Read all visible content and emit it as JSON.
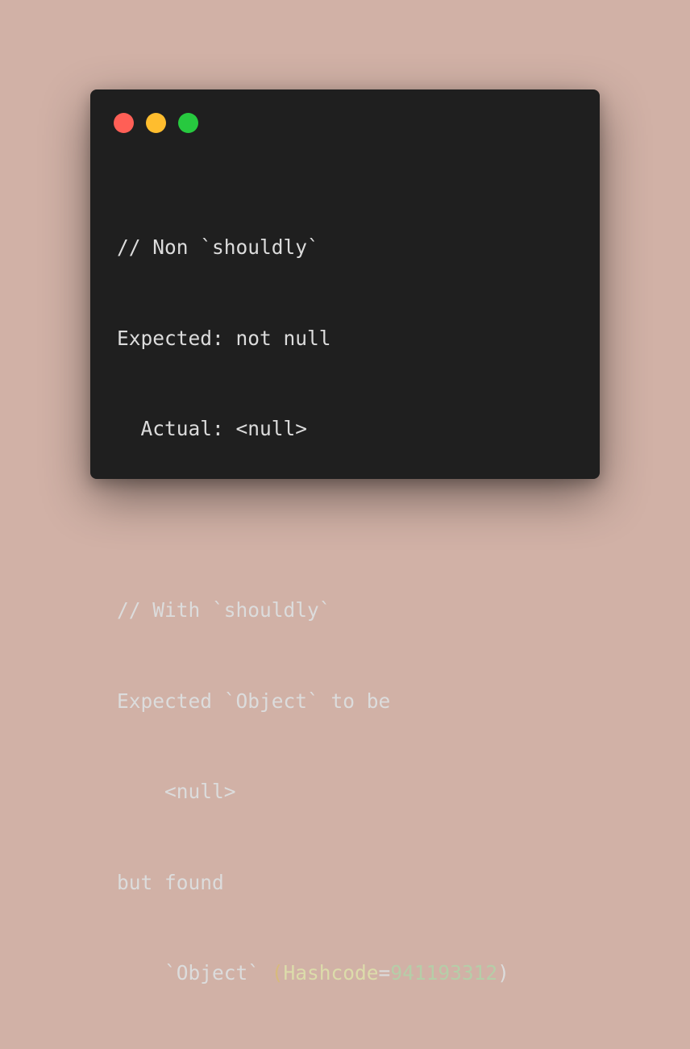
{
  "window": {
    "controls": [
      "close",
      "minimize",
      "zoom"
    ],
    "colors": {
      "background": "#1f1f1f",
      "text": "#dcdcdc",
      "close": "#ff5f56",
      "minimize": "#ffbd2e",
      "zoom": "#27c93f",
      "highlight_key": "#dcdcaa",
      "highlight_number": "#b5cea8"
    }
  },
  "code": {
    "lines": [
      "// Non `shouldly`",
      "Expected: not null",
      "  Actual: <null>",
      "",
      "// With `shouldly`",
      "Expected `Object` to be",
      "    <null>",
      "but found",
      "    `Object` "
    ],
    "last_line": {
      "open": "(",
      "key": "Hashcode",
      "eq": "=",
      "number": "941193312",
      "close": ")"
    }
  }
}
